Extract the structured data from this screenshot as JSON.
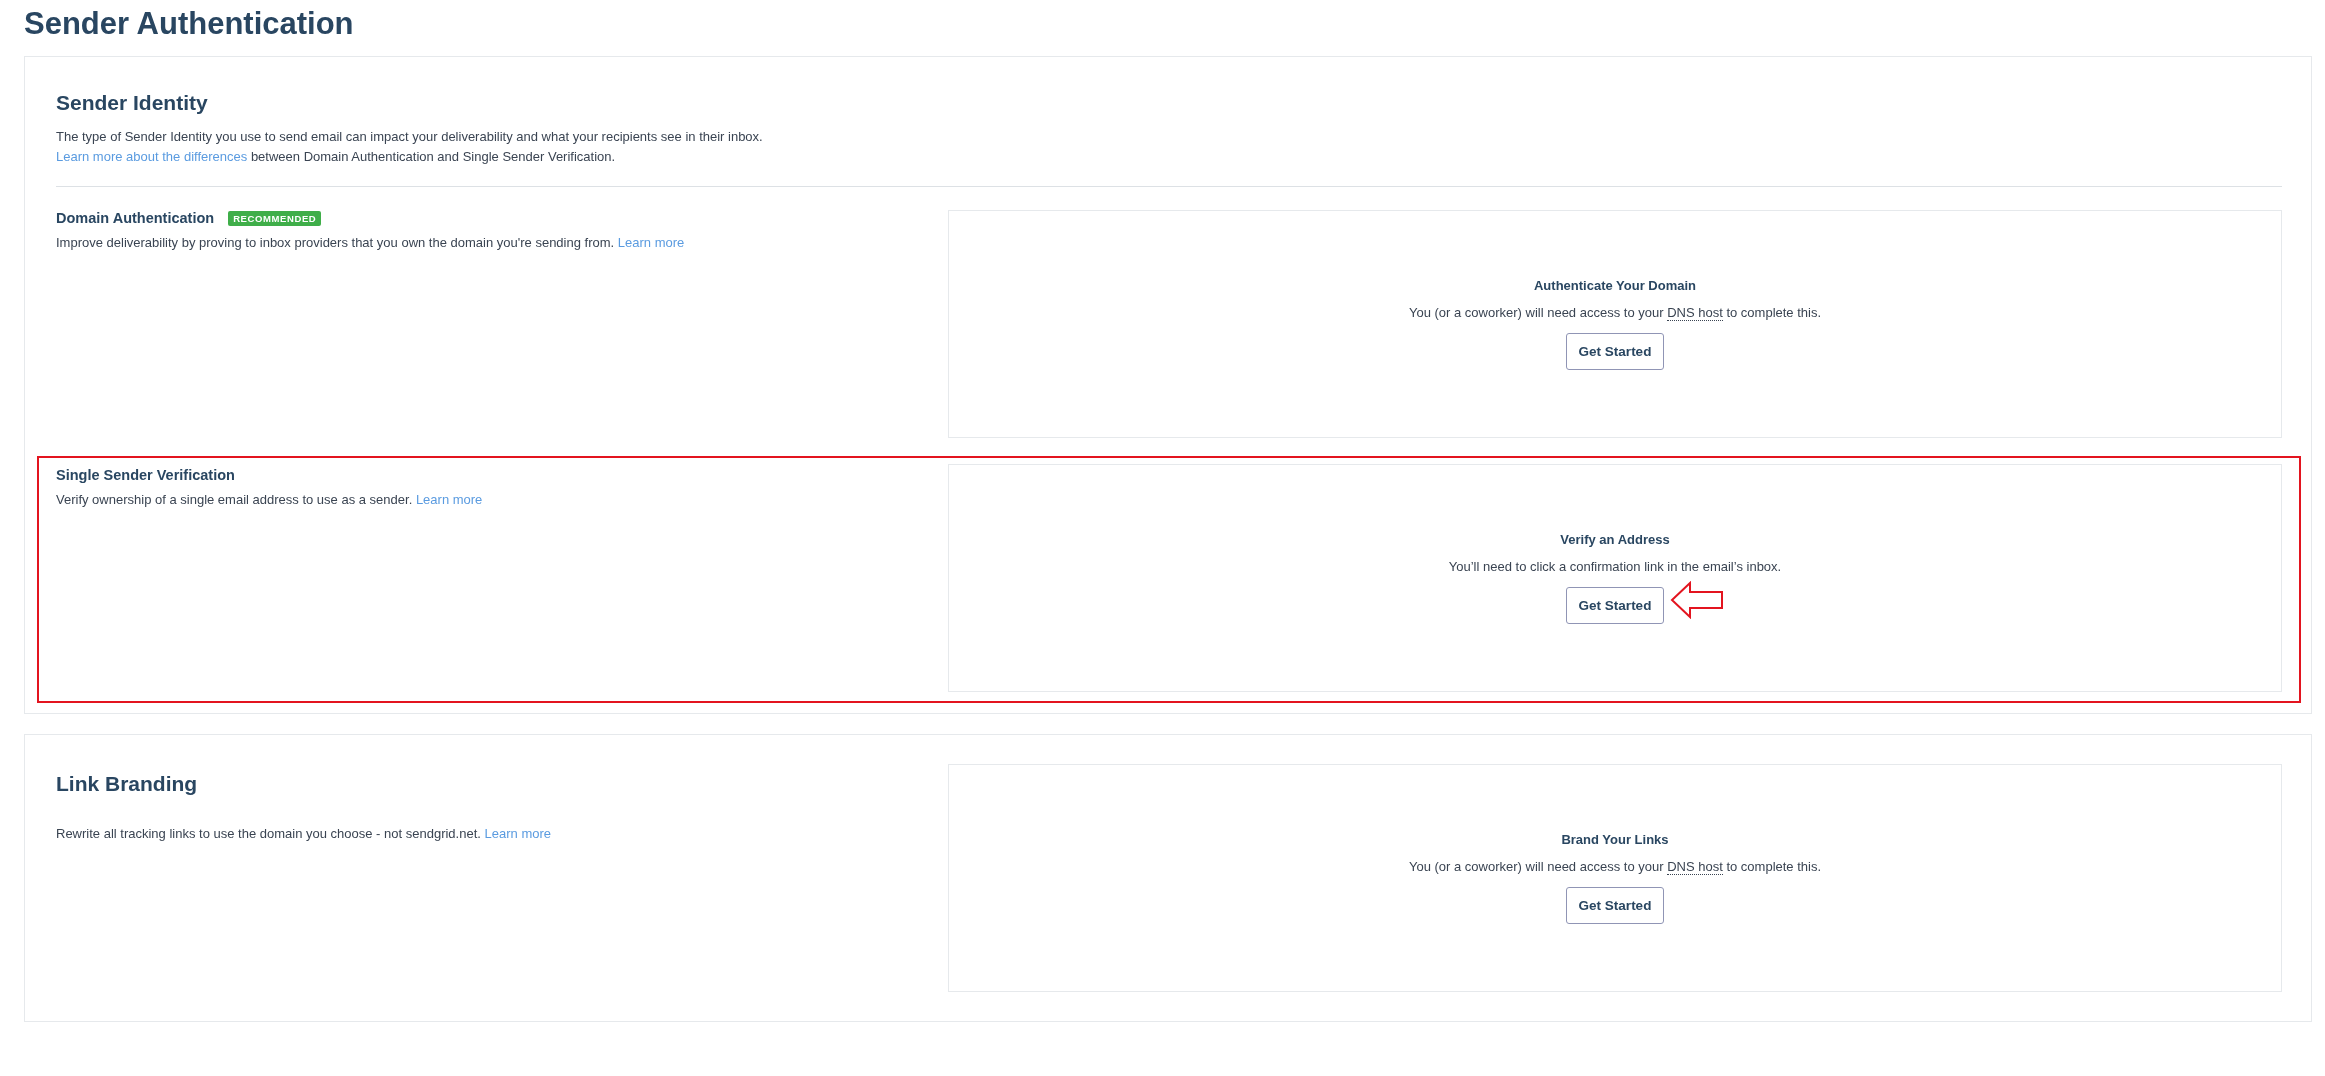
{
  "page_title": "Sender Authentication",
  "panels": [
    {
      "kind": "stacked",
      "title": "Sender Identity",
      "intro_line": "The type of Sender Identity you use to send email can impact your deliverability and what your recipients see in their inbox.",
      "intro_link": "Learn more about the differences",
      "intro_after": " between Domain Authentication and Single Sender Verification.",
      "sections": [
        {
          "name": "Domain Authentication",
          "badge": "RECOMMENDED",
          "description": "Improve deliverability by proving to inbox providers that you own the domain you're sending from.",
          "link": "Learn more",
          "highlighted": false,
          "card": {
            "title": "Authenticate Your Domain",
            "before": "You (or a coworker) will need access to your ",
            "term": "DNS host",
            "after": " to complete this.",
            "button": "Get Started"
          }
        },
        {
          "name": "Single Sender Verification",
          "description": "Verify ownership of a single email address to use as a sender.",
          "link": "Learn more",
          "highlighted": true,
          "card": {
            "title": "Verify an Address",
            "before": "You’ll need to click a confirmation link in the email’s inbox.",
            "button": "Get Started"
          }
        }
      ]
    },
    {
      "kind": "inline",
      "title": "Link Branding",
      "sections": [
        {
          "description": "Rewrite all tracking links to use the domain you choose - not sendgrid.net.",
          "link": "Learn more",
          "highlighted": false,
          "card": {
            "title": "Brand Your Links",
            "before": "You (or a coworker) will need access to your ",
            "term": "DNS host",
            "after": " to complete this.",
            "button": "Get Started"
          }
        }
      ]
    }
  ]
}
